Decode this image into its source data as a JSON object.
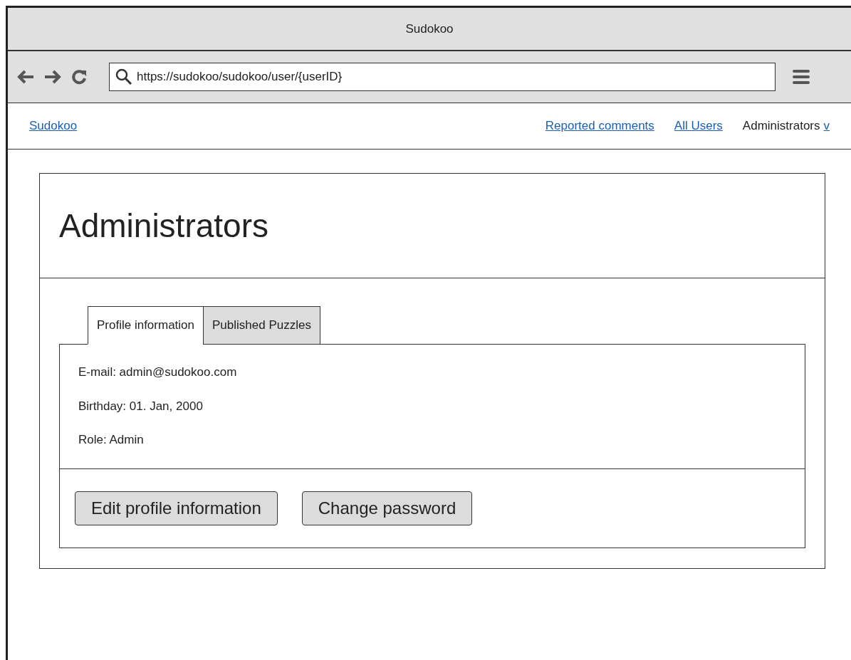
{
  "window": {
    "title": "Sudokoo"
  },
  "browser": {
    "url": "https://sudokoo/sudokoo/user/{userID}"
  },
  "nav": {
    "brand": "Sudokoo",
    "links": [
      "Reported comments",
      "All Users"
    ],
    "current": "Administrators",
    "dropdown": "v"
  },
  "page": {
    "heading": "Administrators",
    "tabs": [
      {
        "label": "Profile information",
        "selected": true
      },
      {
        "label": "Published Puzzles",
        "selected": false
      }
    ],
    "fields": [
      "E-mail: admin@sudokoo.com",
      "Birthday: 01. Jan, 2000",
      "Role: Admin"
    ],
    "buttons": [
      "Edit profile information",
      "Change password"
    ]
  }
}
